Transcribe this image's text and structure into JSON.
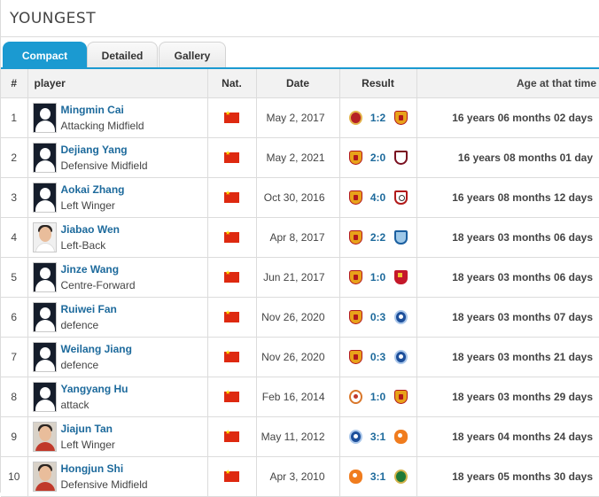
{
  "header": {
    "title": "YOUNGEST"
  },
  "tabs": [
    {
      "label": "Compact",
      "active": true
    },
    {
      "label": "Detailed",
      "active": false
    },
    {
      "label": "Gallery",
      "active": false
    }
  ],
  "colors": {
    "accent": "#1b9ad1",
    "link": "#1d6a9c",
    "header_bg": "#f2f2f2",
    "flag_red": "#de2910"
  },
  "table": {
    "columns": [
      "#",
      "player",
      "Nat.",
      "Date",
      "Result",
      "Age at that time"
    ],
    "rows": [
      {
        "num": "1",
        "name": "Mingmin Cai",
        "position": "Attacking Midfield",
        "nat_icon": "china-flag-icon",
        "date": "May 2, 2017",
        "home_icon": "red-round-crest-icon",
        "score": "1:2",
        "away_icon": "guangzhou-crest-icon",
        "age": "16 years 06 months 02 days"
      },
      {
        "num": "2",
        "name": "Dejiang Yang",
        "position": "Defensive Midfield",
        "nat_icon": "china-flag-icon",
        "date": "May 2, 2021",
        "home_icon": "guangzhou-crest-icon",
        "score": "2:0",
        "away_icon": "dark-red-crest-icon",
        "age": "16 years 08 months 01 day"
      },
      {
        "num": "3",
        "name": "Aokai Zhang",
        "position": "Left Winger",
        "nat_icon": "china-flag-icon",
        "date": "Oct 30, 2016",
        "home_icon": "guangzhou-crest-icon",
        "score": "4:0",
        "away_icon": "white-shield-crest-icon",
        "age": "16 years 08 months 12 days"
      },
      {
        "num": "4",
        "name": "Jiabao Wen",
        "position": "Left-Back",
        "nat_icon": "china-flag-icon",
        "date": "Apr 8, 2017",
        "home_icon": "guangzhou-crest-icon",
        "score": "2:2",
        "away_icon": "blue-shield-crest-icon",
        "age": "18 years 03 months 06 days"
      },
      {
        "num": "5",
        "name": "Jinze Wang",
        "position": "Centre-Forward",
        "nat_icon": "china-flag-icon",
        "date": "Jun 21, 2017",
        "home_icon": "guangzhou-crest-icon",
        "score": "1:0",
        "away_icon": "red-shield-crest-icon",
        "age": "18 years 03 months 06 days"
      },
      {
        "num": "6",
        "name": "Ruiwei Fan",
        "position": "defence",
        "nat_icon": "china-flag-icon",
        "date": "Nov 26, 2020",
        "home_icon": "guangzhou-crest-icon",
        "score": "0:3",
        "away_icon": "blue-round-crest-icon",
        "age": "18 years 03 months 07 days"
      },
      {
        "num": "7",
        "name": "Weilang Jiang",
        "position": "defence",
        "nat_icon": "china-flag-icon",
        "date": "Nov 26, 2020",
        "home_icon": "guangzhou-crest-icon",
        "score": "0:3",
        "away_icon": "blue-round-crest-icon",
        "age": "18 years 03 months 21 days"
      },
      {
        "num": "8",
        "name": "Yangyang Hu",
        "position": "attack",
        "nat_icon": "china-flag-icon",
        "date": "Feb 16, 2014",
        "home_icon": "orange-round-crest-icon",
        "score": "1:0",
        "away_icon": "guangzhou-crest-icon",
        "age": "18 years 03 months 29 days"
      },
      {
        "num": "9",
        "name": "Jiajun Tan",
        "position": "Left Winger",
        "nat_icon": "china-flag-icon",
        "date": "May 11, 2012",
        "home_icon": "blue-round-crest-icon",
        "score": "3:1",
        "away_icon": "orange-shield-crest-icon",
        "age": "18 years 04 months 24 days"
      },
      {
        "num": "10",
        "name": "Hongjun Shi",
        "position": "Defensive Midfield",
        "nat_icon": "china-flag-icon",
        "date": "Apr 3, 2010",
        "home_icon": "orange-shield-crest-icon",
        "score": "3:1",
        "away_icon": "green-round-crest-icon",
        "age": "18 years 05 months 30 days"
      }
    ]
  }
}
